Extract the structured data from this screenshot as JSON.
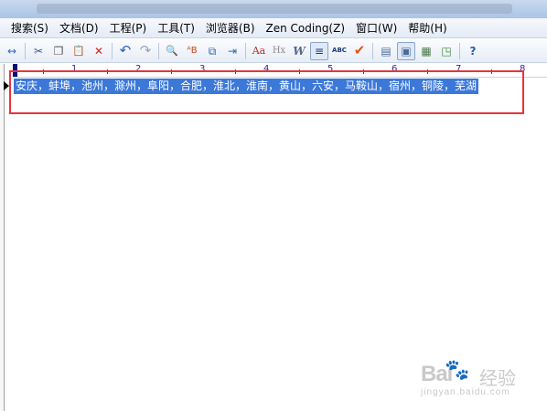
{
  "menubar": {
    "items": [
      "搜索(S)",
      "文档(D)",
      "工程(P)",
      "工具(T)",
      "浏览器(B)",
      "Zen Coding(Z)",
      "窗口(W)",
      "帮助(H)"
    ]
  },
  "toolbar": {
    "icons": [
      {
        "name": "split-view-icon",
        "glyph": "↔"
      },
      {
        "name": "cut-icon",
        "glyph": "✂"
      },
      {
        "name": "copy-icon",
        "glyph": "❐"
      },
      {
        "name": "paste-icon",
        "glyph": "📋"
      },
      {
        "name": "delete-icon",
        "glyph": "✕"
      },
      {
        "name": "undo-icon",
        "glyph": "↶"
      },
      {
        "name": "redo-icon",
        "glyph": "↷"
      },
      {
        "name": "find-icon",
        "glyph": "🔍"
      },
      {
        "name": "replace-icon",
        "glyph": "ᴬB"
      },
      {
        "name": "find-in-files-icon",
        "glyph": "⧉"
      },
      {
        "name": "goto-line-icon",
        "glyph": "⇥"
      },
      {
        "name": "font-icon",
        "glyph": "Aa"
      },
      {
        "name": "html-heading-icon",
        "glyph": "Hx"
      },
      {
        "name": "word-wrap-icon",
        "glyph": "W"
      },
      {
        "name": "line-numbers-icon",
        "glyph": "≡"
      },
      {
        "name": "spell-check-icon",
        "glyph": "ABC"
      },
      {
        "name": "check-icon",
        "glyph": "✔"
      },
      {
        "name": "document-list-icon",
        "glyph": "▤"
      },
      {
        "name": "output-window-icon",
        "glyph": "▣"
      },
      {
        "name": "explorer-icon",
        "glyph": "▦"
      },
      {
        "name": "browser-preview-icon",
        "glyph": "◳"
      },
      {
        "name": "help-icon",
        "glyph": "?"
      }
    ]
  },
  "ruler": {
    "numbers": [
      "1",
      "2",
      "3",
      "4",
      "5",
      "6",
      "7",
      "8"
    ]
  },
  "editor": {
    "line1": "安庆，蚌埠，池州，滁州，阜阳，合肥，淮北，淮南，黄山，六安，马鞍山，宿州，铜陵，芜湖"
  },
  "watermark": {
    "brand": "Bai",
    "paw": "🐾",
    "chinese": "经验",
    "url": "jingyan.baidu.com"
  },
  "colors": {
    "selection": "#3c78d8",
    "highlight_box": "#e8343a"
  }
}
